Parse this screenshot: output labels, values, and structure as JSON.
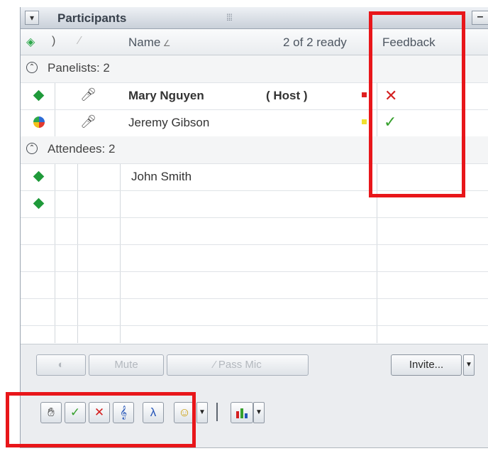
{
  "panel": {
    "title": "Participants"
  },
  "header": {
    "name_label": "Name",
    "ready_status": "2 of 2 ready",
    "feedback_label": "Feedback"
  },
  "groups": {
    "panelists": "Panelists: 2",
    "attendees": "Attendees: 2"
  },
  "participants": [
    {
      "name": "Mary Nguyen",
      "role": "( Host )",
      "feedback": "no",
      "status_color": "#e02020"
    },
    {
      "name": "Jeremy Gibson",
      "feedback": "yes",
      "status_color": "#f0e030"
    },
    {
      "name": "John Smith"
    },
    {
      "name": ""
    }
  ],
  "buttons": {
    "mute": "Mute",
    "pass_mic": "Pass Mic",
    "invite": "Invite..."
  },
  "icons": {
    "feedback_no": "✕",
    "feedback_yes": "✓"
  },
  "colors": {
    "highlight": "#e8161a",
    "online": "#1f9a3a"
  }
}
